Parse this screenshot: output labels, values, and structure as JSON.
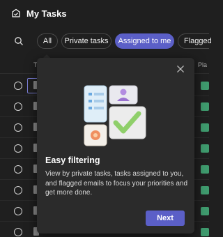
{
  "header": {
    "title": "My Tasks",
    "icon": "tasks-icon"
  },
  "filters": {
    "search_icon": "search-icon",
    "pills": [
      {
        "label": "All"
      },
      {
        "label": "Private tasks"
      },
      {
        "label": "Assigned to me",
        "active": true
      },
      {
        "label": "Flagged"
      }
    ]
  },
  "list": {
    "col_title": "T",
    "col_plan": "Pla",
    "rows": 8
  },
  "popover": {
    "heading": "Easy filtering",
    "body": "View by private tasks, tasks assigned to you, and flagged emails to focus your priorities and get more done.",
    "next_label": "Next",
    "close_icon": "close-icon"
  },
  "colors": {
    "accent": "#5b5fc7",
    "background": "#1f1f1f",
    "popover": "#2b2b2b",
    "plan_badge": "#3f9b6e"
  }
}
